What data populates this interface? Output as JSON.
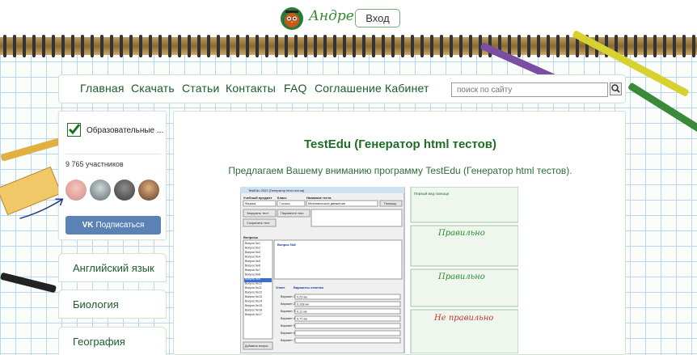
{
  "header": {
    "signature": "Андрей",
    "login_label": "Вход"
  },
  "nav": {
    "items": [
      "Главная",
      "Скачать",
      "Статьи",
      "Контакты",
      "FAQ",
      "Соглашение",
      "Кабинет"
    ],
    "search_placeholder": "поиск по сайту"
  },
  "widget": {
    "title": "Образовательные ...",
    "members": "9 765 участников",
    "subscribe_label": "Подписаться",
    "subscribe_icon": "vk-icon"
  },
  "subjects": [
    "Английский язык",
    "Биология",
    "География"
  ],
  "main": {
    "title": "TestEdu (Генератор html тестов)",
    "intro": "Предлагаем Вашему вниманию программу TestEdu (Генератор html тестов)."
  },
  "screenshot_preview": {
    "window_title": "TestEdu 2022 (Генератор html тестов)",
    "subject_label": "Учебный предмет",
    "subject_value": "Физика",
    "class_label": "Класс",
    "class_value": "7 класс",
    "test_name_label": "Название теста",
    "test_name_value": "Механическое движение",
    "help_btn": "Помощь",
    "load_btn": "Загрузить тест",
    "new_btn": "Перевести тест",
    "save_btn": "Сохранить тест",
    "questions_label": "Вопросы",
    "question_items": [
      "Вопрос №1",
      "Вопрос №2",
      "Вопрос №3",
      "Вопрос №4",
      "Вопрос №5",
      "Вопрос №6",
      "Вопрос №7",
      "Вопрос №8",
      "Вопрос №9",
      "Вопрос №10",
      "Вопрос №11",
      "Вопрос №12",
      "Вопрос №13",
      "Вопрос №14",
      "Вопрос №15",
      "Вопрос №16",
      "Вопрос №17"
    ],
    "question_heading": "Вопрос №8",
    "answer_label": "Ответ",
    "variants_label": "Варианты ответов",
    "variants": [
      "Вариант 1",
      "Вариант 2",
      "Вариант 3",
      "Вариант 4",
      "Вариант 5",
      "Вариант 6",
      "Вариант 7"
    ],
    "variant_values": [
      "0,23 км",
      "0,108 км",
      "0,11 км",
      "0,77 км",
      "",
      "",
      ""
    ],
    "add_btn": "Добавить вопрос",
    "result_title": "Первый вид помощи",
    "right_label": "Правильно",
    "wrong_label": "Не правильно"
  },
  "colors": {
    "accent": "#1f6e25",
    "vk": "#5b82b5",
    "grid": "#b9d7ee"
  }
}
